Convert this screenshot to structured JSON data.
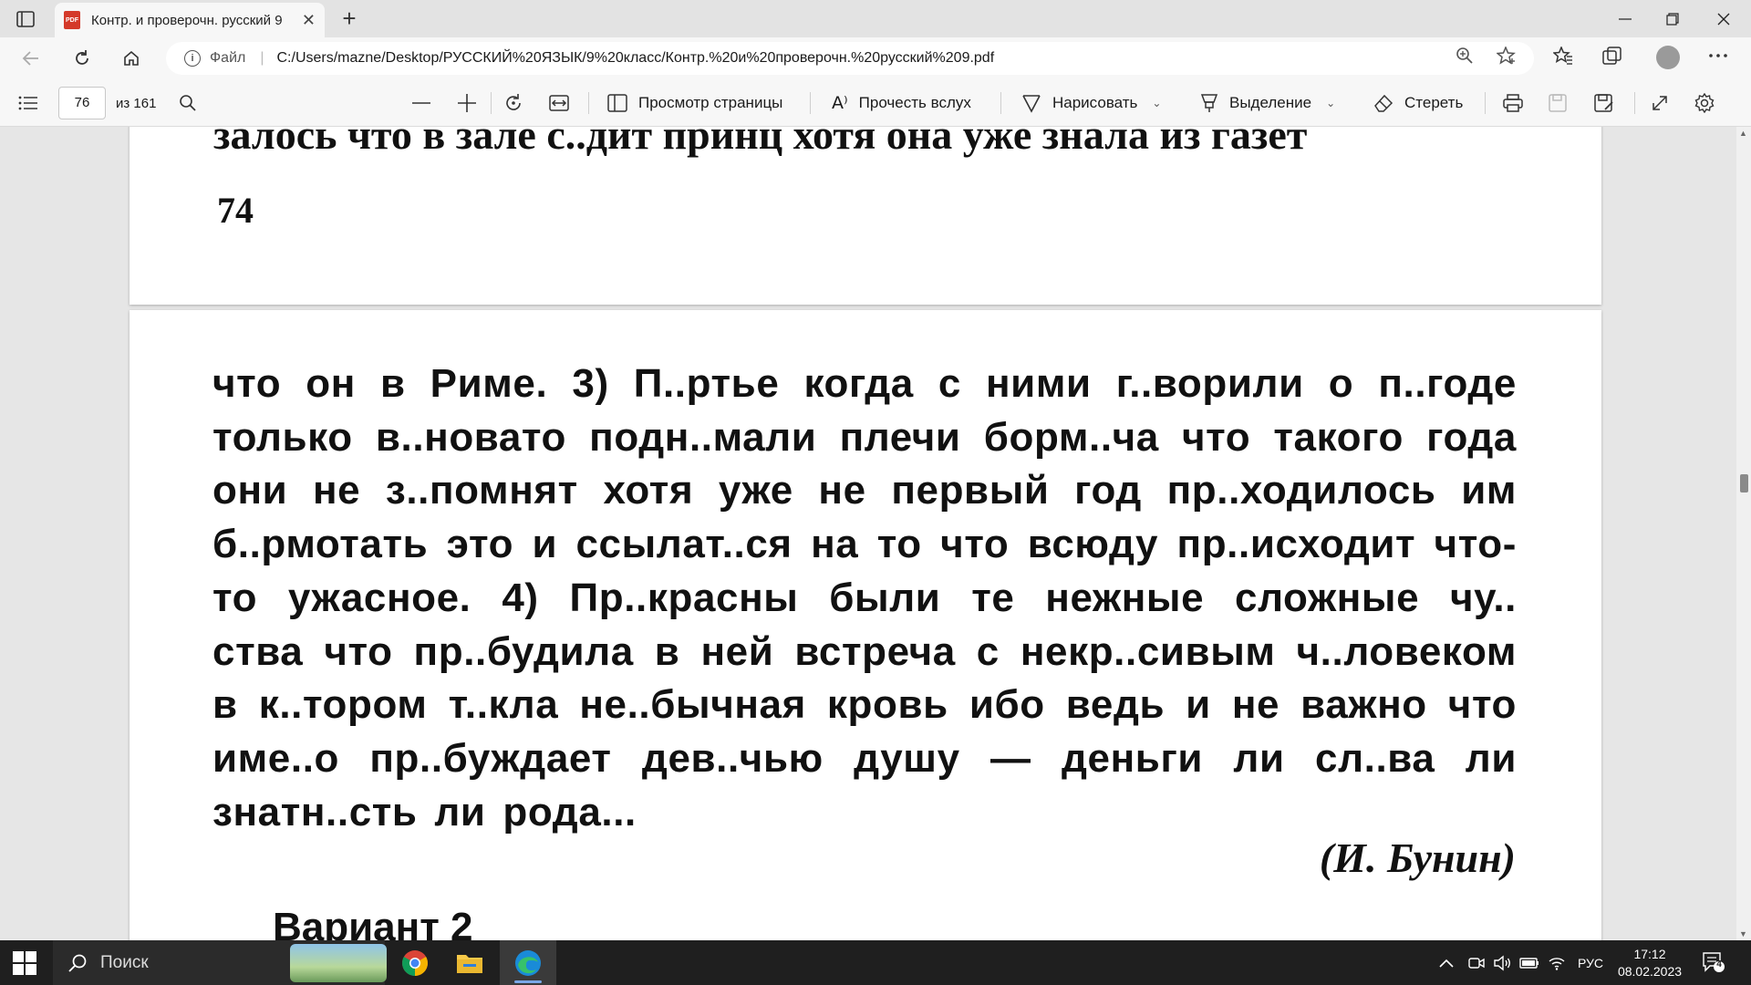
{
  "browser": {
    "tab_title": "Контр. и проверочн. русский 9",
    "new_tab_label": "+",
    "address": {
      "scheme_label": "Файл",
      "url": "C:/Users/mazne/Desktop/РУССКИЙ%20ЯЗЫК/9%20класс/Контр.%20и%20проверочн.%20русский%209.pdf"
    }
  },
  "pdf_toolbar": {
    "current_page": "76",
    "total_pages": "из 161",
    "page_view_label": "Просмотр страницы",
    "read_aloud_label": "Прочесть вслух",
    "draw_label": "Нарисовать",
    "highlight_label": "Выделение",
    "erase_label": "Стереть"
  },
  "document": {
    "prev_page_cut_text": "залось что в зале с..дит принц хотя она уже знала из газет",
    "prev_page_number": "74",
    "lines": [
      "что он в Риме. 3) П..ртье когда с ними г..ворили о п..годе",
      "только в..новато подн..мали плечи борм..ча что такого года",
      "они не з..помнят хотя уже не первый год пр..ходилось им",
      "б..рмотать это и ссылат..ся на то что всюду пр..исходит что-",
      "то ужасное. 4) Пр..красны были те нежные сложные чу..",
      "ства что пр..будила в ней встреча с некр..сивым ч..ловеком",
      "в к..тором т..кла не..бычная кровь ибо ведь и не важно что",
      "име..о пр..буждает дев..чью душу — деньги ли сл..ва ли",
      "знатн..сть ли рода..."
    ],
    "author": "(И. Бунин)",
    "next_heading": "Вариант 2"
  },
  "taskbar": {
    "search_label": "Поиск",
    "language": "РУС",
    "time": "17:12",
    "date": "08.02.2023",
    "notification_count": "4"
  }
}
